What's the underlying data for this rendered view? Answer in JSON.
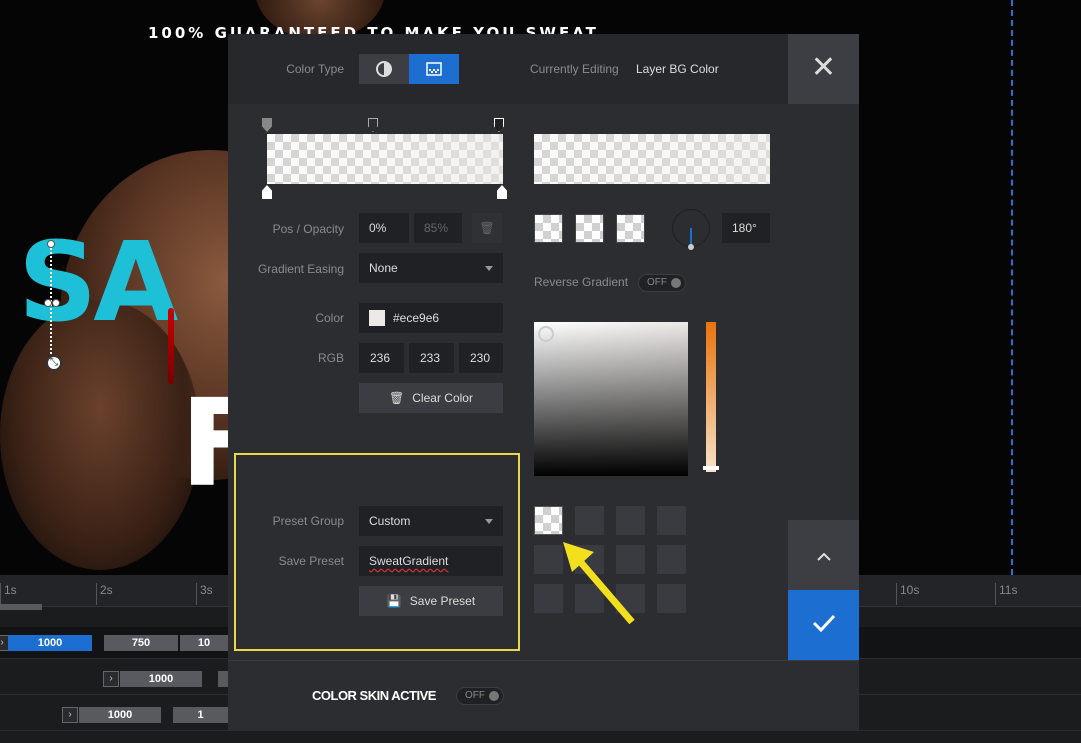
{
  "background": {
    "tagline": "100% GUARANTEED TO MAKE YOU SWEAT",
    "headline_fragment": "SA",
    "headline_fragment2": "F"
  },
  "timeline": {
    "ruler_ticks": [
      "1s",
      "2s",
      "3s",
      "10s",
      "11s"
    ],
    "rows": [
      {
        "chips": [
          "1000",
          "750",
          "10"
        ]
      },
      {
        "chips": [
          "1000"
        ]
      },
      {
        "chips": [
          "1000",
          "1"
        ]
      }
    ]
  },
  "dialog": {
    "color_type_label": "Color Type",
    "currently_editing_label": "Currently Editing",
    "currently_editing_value": "Layer BG Color",
    "pos_opacity_label": "Pos / Opacity",
    "pos_value": "0%",
    "opacity_value": "85%",
    "gradient_easing_label": "Gradient Easing",
    "gradient_easing_value": "None",
    "color_label": "Color",
    "color_hex": "#ece9e6",
    "color_swatch": "#ece9e6",
    "rgb_label": "RGB",
    "rgb": [
      "236",
      "233",
      "230"
    ],
    "clear_color_label": "Clear Color",
    "angle_value": "180°",
    "reverse_gradient_label": "Reverse Gradient",
    "reverse_gradient_state": "OFF",
    "preset_group_label": "Preset Group",
    "preset_group_value": "Custom",
    "save_preset_label": "Save Preset",
    "save_preset_input_value": "SweatGradient",
    "save_preset_button_label": "Save Preset",
    "color_skin_label": "COLOR SKIN ACTIVE",
    "color_skin_state": "OFF",
    "accent_color": "#1c6fd1",
    "highlight_color": "#e8d84a"
  }
}
